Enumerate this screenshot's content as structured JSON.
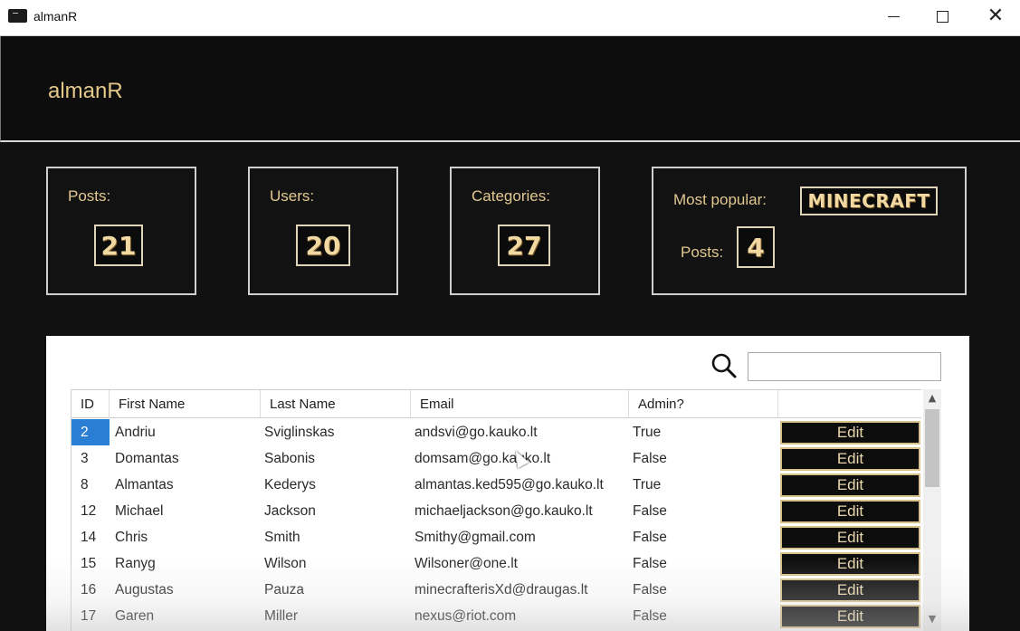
{
  "window": {
    "title": "almanR"
  },
  "header": {
    "app_name": "almanR"
  },
  "stats": {
    "posts": {
      "label": "Posts:",
      "value": "21"
    },
    "users": {
      "label": "Users:",
      "value": "20"
    },
    "categories": {
      "label": "Categories:",
      "value": "27"
    },
    "most_popular": {
      "label": "Most popular:",
      "value": "MINECRAFT",
      "posts_label": "Posts:",
      "posts_value": "4"
    }
  },
  "search": {
    "value": "",
    "icon": "search-icon"
  },
  "table": {
    "columns": [
      "ID",
      "First Name",
      "Last Name",
      "Email",
      "Admin?",
      ""
    ],
    "selected_row": 0,
    "edit_label": "Edit",
    "rows": [
      {
        "id": "2",
        "first": "Andriu",
        "last": "Sviglinskas",
        "email": "andsvi@go.kauko.lt",
        "admin": "True"
      },
      {
        "id": "3",
        "first": "Domantas",
        "last": "Sabonis",
        "email": "domsam@go.kauko.lt",
        "admin": "False"
      },
      {
        "id": "8",
        "first": "Almantas",
        "last": "Kederys",
        "email": "almantas.ked595@go.kauko.lt",
        "admin": "True"
      },
      {
        "id": "12",
        "first": "Michael",
        "last": "Jackson",
        "email": "michaeljackson@go.kauko.lt",
        "admin": "False"
      },
      {
        "id": "14",
        "first": "Chris",
        "last": "Smith",
        "email": "Smithy@gmail.com",
        "admin": "False"
      },
      {
        "id": "15",
        "first": "Ranyg",
        "last": "Wilson",
        "email": "Wilsoner@one.lt",
        "admin": "False"
      },
      {
        "id": "16",
        "first": "Augustas",
        "last": "Pauza",
        "email": "minecrafterisXd@draugas.lt",
        "admin": "False"
      },
      {
        "id": "17",
        "first": "Garen",
        "last": "Miller",
        "email": "nexus@riot.com",
        "admin": "False"
      }
    ]
  },
  "colors": {
    "background": "#111111",
    "accent_gold": "#e2c890",
    "selection_blue": "#2a7fd4"
  }
}
